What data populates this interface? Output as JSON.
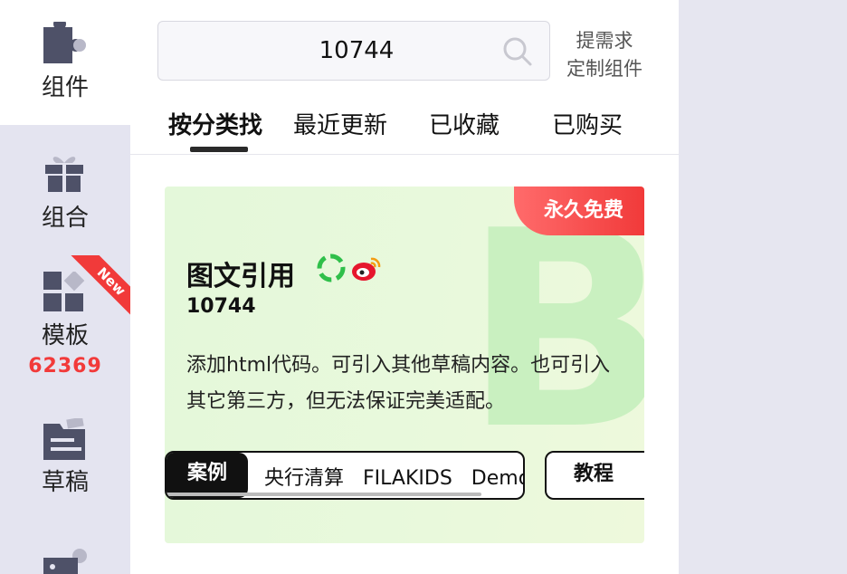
{
  "sidebar": {
    "items": [
      {
        "label": "组件",
        "icon": "puzzle-icon",
        "active": true
      },
      {
        "label": "组合",
        "icon": "gift-icon"
      },
      {
        "label": "模板",
        "icon": "template-grid-icon",
        "count": "62369",
        "badge": "New"
      },
      {
        "label": "草稿",
        "icon": "folder-icon"
      },
      {
        "label": "",
        "icon": "image-icon"
      }
    ]
  },
  "search": {
    "value": "10744",
    "custom_request": [
      "提需求",
      "定制组件"
    ]
  },
  "tabs": [
    {
      "label": "按分类找",
      "active": true
    },
    {
      "label": "最近更新"
    },
    {
      "label": "已收藏"
    },
    {
      "label": "已购买"
    }
  ],
  "card": {
    "badge": "永久免费",
    "title": "图文引用",
    "id": "10744",
    "description": "添加html代码。可引入其他草稿内容。也可引入其它第三方，但无法保证完美适配。",
    "watermark": "B",
    "examples_label": "案例",
    "examples": [
      "央行清算",
      "FILAKIDS",
      "Demo"
    ],
    "tutorial_label": "教程"
  },
  "colors": {
    "accent_red": "#f13a3a",
    "card_green": "#e6f8da",
    "sidebar_bg": "#e4e4f0"
  }
}
